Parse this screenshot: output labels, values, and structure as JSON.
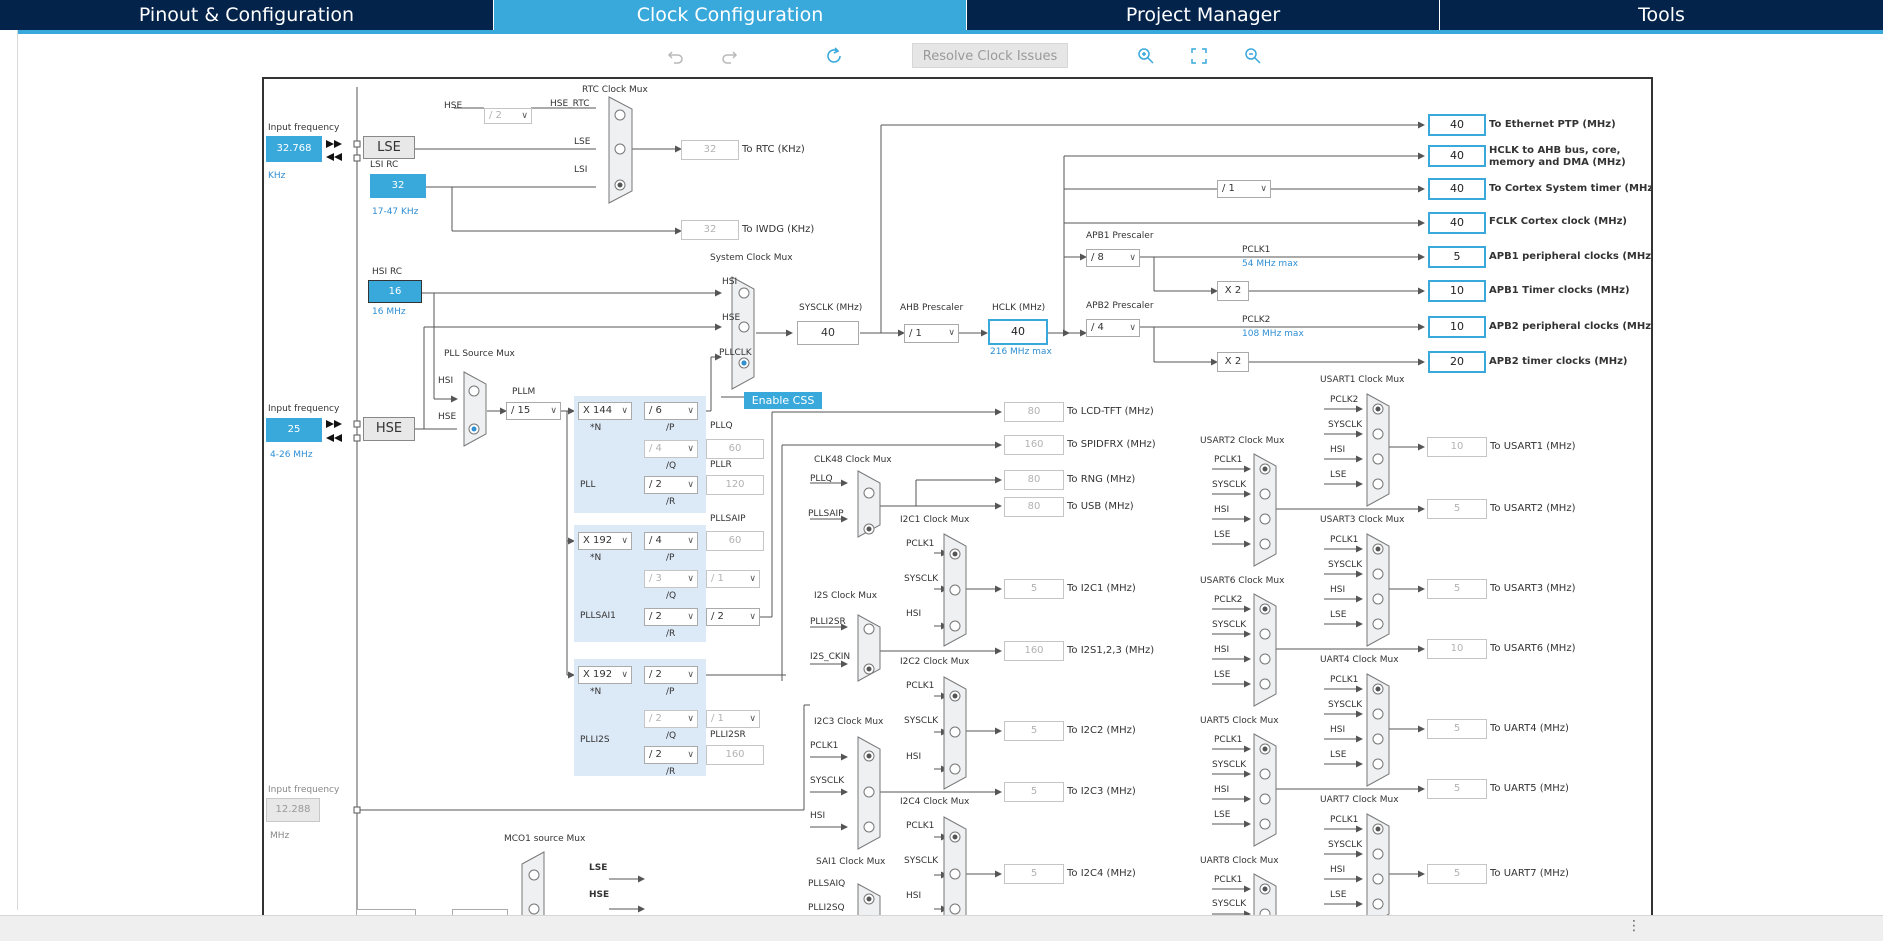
{
  "tabs": [
    "Pinout & Configuration",
    "Clock Configuration",
    "Project Manager",
    "Tools"
  ],
  "toolbar": {
    "resolve_label": "Resolve Clock Issues",
    "icons": [
      "undo-icon",
      "redo-icon",
      "refresh-icon",
      "zoom-in-icon",
      "fit-screen-icon",
      "zoom-out-icon"
    ]
  },
  "colors": {
    "nav": "#03234b",
    "accent": "#39a9dc",
    "pll_bg": "#dce9f7"
  },
  "diagram": {
    "input_frequency_label": "Input frequency",
    "lse": {
      "value": "32.768",
      "unit": "KHz",
      "name": "LSE"
    },
    "lsi": {
      "title": "LSI RC",
      "value": "32",
      "range": "17-47 KHz"
    },
    "hsi": {
      "title": "HSI RC",
      "value": "16",
      "freq": "16 MHz"
    },
    "hse": {
      "value": "25",
      "range": "4-26 MHz",
      "name": "HSE"
    },
    "ext": {
      "value": "12.288",
      "unit": "MHz"
    },
    "rtc": {
      "title": "RTC Clock Mux",
      "hse_div": "/ 2",
      "in_hse": "HSE",
      "in_hse_rtc": "HSE_RTC",
      "in_lse": "LSE",
      "in_lsi": "LSI",
      "out_value": "32",
      "out_label": "To RTC (KHz)"
    },
    "iwdg": {
      "out_value": "32",
      "out_label": "To IWDG (KHz)"
    },
    "sysmux": {
      "title": "System Clock Mux",
      "in_hsi": "HSI",
      "in_hse": "HSE",
      "in_pll": "PLLCLK",
      "css": "Enable CSS"
    },
    "pllsrc": {
      "title": "PLL Source Mux",
      "in_hsi": "HSI",
      "in_hse": "HSE"
    },
    "pllm": {
      "title": "PLLM",
      "value": "/ 15"
    },
    "pll": {
      "n": "X 144",
      "n_lbl": "*N",
      "p": "/ 6",
      "p_lbl": "/P",
      "q": "/ 4",
      "q_lbl": "/Q",
      "r": "/ 2",
      "r_lbl": "/R",
      "pllq": "PLLQ",
      "pllq_val": "60",
      "pllr": "PLLR",
      "pllr_val": "120",
      "name": "PLL"
    },
    "pllsai1": {
      "n": "X 192",
      "n_lbl": "*N",
      "p": "/ 4",
      "p_lbl": "/P",
      "q": "/ 3",
      "q_lbl": "/Q",
      "q2": "/ 1",
      "r": "/ 2",
      "r_lbl": "/R",
      "r2": "/ 2",
      "pllsaip": "PLLSAIP",
      "pllsaip_val": "60",
      "name": "PLLSAI1"
    },
    "plli2s": {
      "n": "X 192",
      "n_lbl": "*N",
      "p": "/ 2",
      "p_lbl": "/P",
      "q": "/ 2",
      "q_lbl": "/Q",
      "q2": "/ 1",
      "r": "/ 2",
      "r_lbl": "/R",
      "plli2sr": "PLLI2SR",
      "plli2sr_val": "160",
      "name": "PLLI2S"
    },
    "sysclk": {
      "title": "SYSCLK (MHz)",
      "value": "40"
    },
    "ahb": {
      "title": "AHB Prescaler",
      "value": "/ 1"
    },
    "hclk": {
      "title": "HCLK (MHz)",
      "value": "40",
      "max": "216 MHz max"
    },
    "apb1": {
      "title": "APB1 Prescaler",
      "value": "/ 8",
      "pclk": "PCLK1",
      "max": "54 MHz max",
      "x2": "X 2"
    },
    "apb2": {
      "title": "APB2 Prescaler",
      "value": "/ 4",
      "pclk": "PCLK2",
      "max": "108 MHz max",
      "x2": "X 2"
    },
    "cortex_div": "/ 1",
    "outputs": [
      {
        "value": "40",
        "label": "To Ethernet PTP (MHz)"
      },
      {
        "value": "40",
        "label": "HCLK to AHB bus, core,",
        "label2": "memory and DMA (MHz)"
      },
      {
        "value": "40",
        "label": "To Cortex System timer (MHz)"
      },
      {
        "value": "40",
        "label": "FCLK Cortex clock (MHz)"
      },
      {
        "value": "5",
        "label": "APB1 peripheral clocks (MHz)"
      },
      {
        "value": "10",
        "label": "APB1 Timer clocks (MHz)"
      },
      {
        "value": "10",
        "label": "APB2 peripheral clocks (MHz)"
      },
      {
        "value": "20",
        "label": "APB2 timer clocks (MHz)"
      }
    ],
    "lcd": {
      "value": "80",
      "label": "To LCD-TFT (MHz)"
    },
    "spdif": {
      "value": "160",
      "label": "To SPIDFRX (MHz)"
    },
    "rng": {
      "value": "80",
      "label": "To RNG (MHz)"
    },
    "usb": {
      "value": "80",
      "label": "To USB (MHz)"
    },
    "clk48": {
      "title": "CLK48 Clock Mux",
      "in1": "PLLQ",
      "in2": "PLLSAIP"
    },
    "i2s": {
      "title": "I2S Clock Mux",
      "in1": "PLLI2SR",
      "in2": "I2S_CKIN",
      "value": "160",
      "label": "To I2S1,2,3 (MHz)"
    },
    "i2c1": {
      "title": "I2C1 Clock Mux",
      "in1": "PCLK1",
      "in2": "SYSCLK",
      "in3": "HSI",
      "value": "5",
      "label": "To I2C1 (MHz)"
    },
    "i2c2": {
      "title": "I2C2 Clock Mux",
      "in1": "PCLK1",
      "in2": "SYSCLK",
      "in3": "HSI",
      "value": "5",
      "label": "To I2C2 (MHz)"
    },
    "i2c3": {
      "title": "I2C3 Clock Mux",
      "in1": "PCLK1",
      "in2": "SYSCLK",
      "in3": "HSI",
      "value": "5",
      "label": "To I2C3 (MHz)"
    },
    "i2c4": {
      "title": "I2C4 Clock Mux",
      "in1": "PCLK1",
      "in2": "SYSCLK",
      "in3": "HSI",
      "value": "5",
      "label": "To I2C4 (MHz)"
    },
    "sai1": {
      "title": "SAI1 Clock Mux",
      "in1": "PLLSAIQ",
      "in2": "PLLI2SQ"
    },
    "mco1": {
      "title": "MCO1 source Mux",
      "in1": "LSE",
      "in2": "HSE"
    },
    "usart1": {
      "title": "USART1 Clock Mux",
      "in1": "PCLK2",
      "in2": "SYSCLK",
      "in3": "HSI",
      "in4": "LSE",
      "value": "10",
      "label": "To USART1 (MHz)"
    },
    "usart2": {
      "title": "USART2 Clock Mux",
      "in1": "PCLK1",
      "in2": "SYSCLK",
      "in3": "HSI",
      "in4": "LSE",
      "value": "5",
      "label": "To USART2 (MHz)"
    },
    "usart3": {
      "title": "USART3 Clock Mux",
      "in1": "PCLK1",
      "in2": "SYSCLK",
      "in3": "HSI",
      "in4": "LSE",
      "value": "5",
      "label": "To USART3 (MHz)"
    },
    "usart6": {
      "title": "USART6 Clock Mux",
      "in1": "PCLK2",
      "in2": "SYSCLK",
      "in3": "HSI",
      "in4": "LSE",
      "value": "10",
      "label": "To USART6 (MHz)"
    },
    "uart4": {
      "title": "UART4 Clock Mux",
      "in1": "PCLK1",
      "in2": "SYSCLK",
      "in3": "HSI",
      "in4": "LSE",
      "value": "5",
      "label": "To UART4 (MHz)"
    },
    "uart5": {
      "title": "UART5 Clock Mux",
      "in1": "PCLK1",
      "in2": "SYSCLK",
      "in3": "HSI",
      "in4": "LSE",
      "value": "5",
      "label": "To UART5 (MHz)"
    },
    "uart7": {
      "title": "UART7 Clock Mux",
      "in1": "PCLK1",
      "in2": "SYSCLK",
      "in3": "HSI",
      "in4": "LSE",
      "value": "5",
      "label": "To UART7 (MHz)"
    },
    "uart8": {
      "title": "UART8 Clock Mux",
      "in1": "PCLK1",
      "in2": "SYSCLK"
    }
  }
}
